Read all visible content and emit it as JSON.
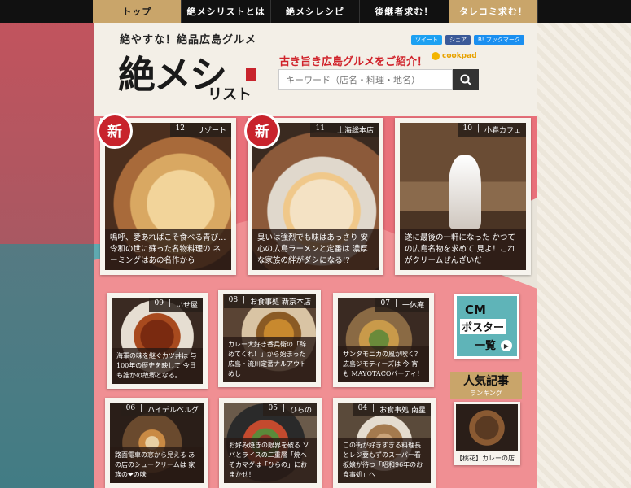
{
  "nav": {
    "tabs": [
      "トップ",
      "絶メシリストとは",
      "絶メシレシピ",
      "後継者求む！",
      "タレコミ求む！"
    ]
  },
  "header": {
    "logo_sub": "絶やすな！絶品広島グルメ",
    "logo_main": "絶メシ",
    "logo_main2": "リスト",
    "tagline": "古き旨き広島グルメをご紹介！",
    "share": [
      "ツイート",
      "シェア",
      "B! ブックマーク"
    ],
    "cookpad": "cookpad",
    "search_placeholder": "キーワード（店名・料理・地名）"
  },
  "cards": [
    {
      "num": "12",
      "shop": "リゾート",
      "caption": "嗚呼、愛あればこそ食べる青び… 令和の世に蘇った名物料理の ネーミングはあの名作から",
      "new_badge": "新"
    },
    {
      "num": "11",
      "shop": "上海総本店",
      "caption": "臭いは強烈でも味はあっさり 安心の広島ラーメンと定番は 濃厚な家族の絆がダシになる!?",
      "new_badge": "新"
    },
    {
      "num": "10",
      "shop": "小春カフェ",
      "caption": "遂に最後の一軒になった かつての広島名物を求めて 見よ！これがクリームぜんざいだ"
    },
    {
      "num": "09",
      "shop": "いせ屋",
      "caption": "海軍の味を継ぐカツ丼は 与100年の歴史を映して 今日も誰かの故郷となる。"
    },
    {
      "num": "08",
      "shop": "お食事処 新京本店",
      "caption": "カレー大好き香兵衛の「辞めてくれ！」から始まった 広島・流川定番ナルアウトめし"
    },
    {
      "num": "07",
      "shop": "一休庵",
      "caption": "サンタモニカの風が吹く？ 広島ジモティーズは 今 宵 も MAYOTACOパーティ！"
    },
    {
      "num": "06",
      "shop": "ハイデルベルグ",
      "caption": "路面電車の窓から見える あの店のシュークリームは 家族の❤の味"
    },
    {
      "num": "05",
      "shop": "ひらの",
      "caption": "お好み焼きの限界を破る ソバとライスの二重層「焼へそカマグは「ひらの」におまかせ！"
    },
    {
      "num": "04",
      "shop": "お食事処 南星",
      "caption": "この街が好きすぎる料理長とレジ要もずのスーパー看板娘が待つ「昭和96年のお食事処」へ"
    }
  ],
  "sidebar": {
    "cm_line1": "CM",
    "cm_line2": "ポスター",
    "cm_line3": "一覧",
    "ranking_title": "人気記事",
    "ranking_sub": "ランキング",
    "rank_caption": "【桃花】カレーの店"
  }
}
